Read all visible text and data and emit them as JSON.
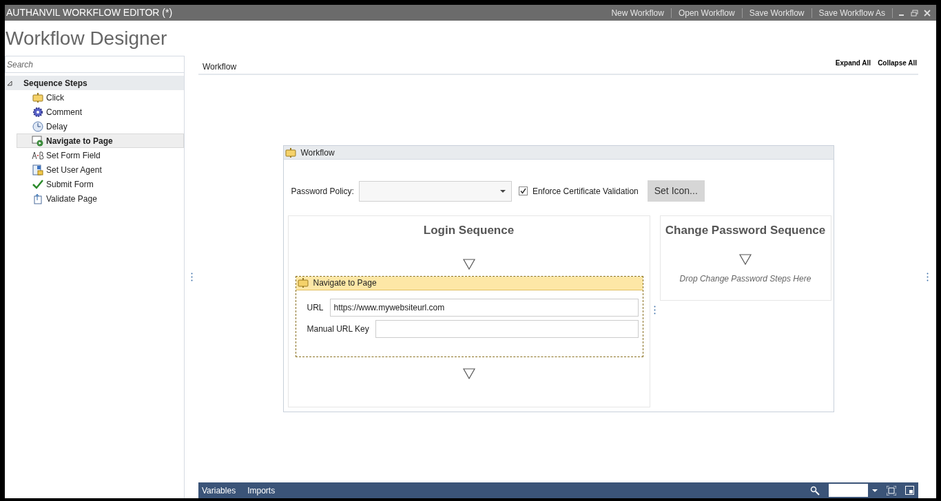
{
  "window": {
    "title": "AUTHANVIL WORKFLOW EDITOR (*)",
    "menu": [
      "New Workflow",
      "Open Workflow",
      "Save Workflow",
      "Save Workflow As"
    ]
  },
  "page_title": "Workflow Designer",
  "search": {
    "placeholder": "Search"
  },
  "tree": [
    {
      "label": "Sequence Steps",
      "expanded": true,
      "selected": false,
      "children": [
        {
          "label": "Click",
          "kind": "click",
          "selected": false
        },
        {
          "label": "Comment",
          "kind": "comment",
          "selected": false
        },
        {
          "label": "Delay",
          "kind": "delay",
          "selected": false
        },
        {
          "label": "Navigate to Page",
          "kind": "navigate",
          "selected": true
        },
        {
          "label": "Set Form Field",
          "kind": "formfield",
          "selected": false
        },
        {
          "label": "Set User Agent",
          "kind": "useragent",
          "selected": false
        },
        {
          "label": "Submit Form",
          "kind": "submit",
          "selected": false
        },
        {
          "label": "Validate Page",
          "kind": "validate",
          "selected": false
        }
      ]
    }
  ],
  "designer": {
    "breadcrumb": "Workflow",
    "actions": [
      "Expand All",
      "Collapse All"
    ],
    "workflow": {
      "title": "Workflow",
      "password_policy_label": "Password Policy:",
      "enforce_label": "Enforce Certificate Validation",
      "enforce_checked": true,
      "set_icon_button": "Set Icon...",
      "login": {
        "title": "Login Sequence",
        "step": {
          "title": "Navigate to Page",
          "fields": [
            {
              "label": "URL",
              "value": "https://www.mywebsiteurl.com"
            },
            {
              "label": "Manual URL Key"
            }
          ]
        }
      },
      "change": {
        "title": "Change Password Sequence",
        "hint": "Drop Change Password Steps Here"
      }
    }
  },
  "bottom_tabs": [
    "Variables",
    "Imports"
  ]
}
